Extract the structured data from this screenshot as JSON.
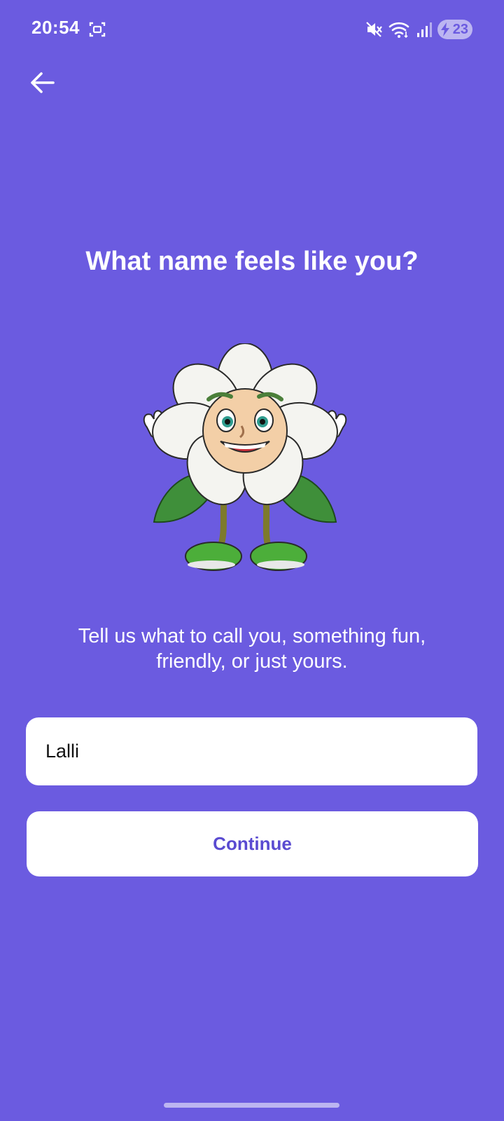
{
  "status_bar": {
    "time": "20:54",
    "battery_level": "23",
    "icons": [
      "screenshot-icon",
      "mute-icon",
      "wifi-icon",
      "signal-icon",
      "battery-charging-icon"
    ]
  },
  "header": {
    "back_icon": "arrow-left-icon"
  },
  "main": {
    "title": "What name feels like you?",
    "mascot_icon": "flower-mascot",
    "subtitle": "Tell us what to call you, something fun, friendly, or just yours.",
    "name_input": {
      "value": "Lalli"
    },
    "continue_label": "Continue"
  },
  "colors": {
    "background": "#6b5be0",
    "button_text": "#5a4bd1",
    "surface": "#ffffff"
  }
}
